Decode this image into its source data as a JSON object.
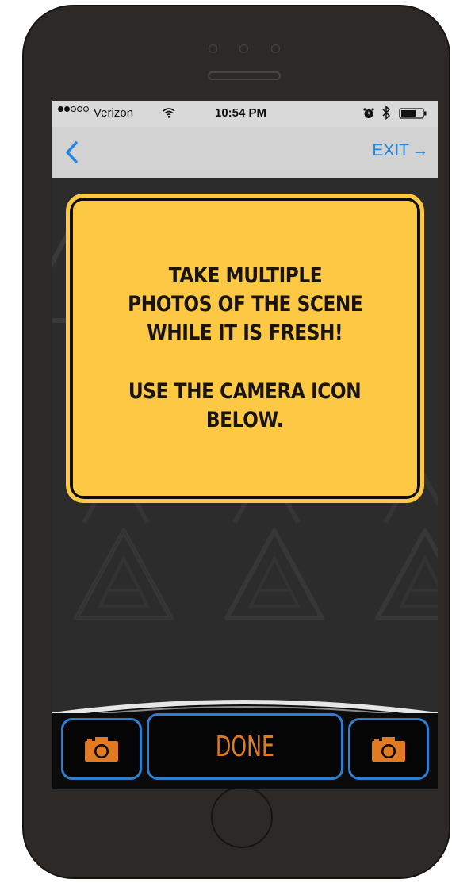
{
  "status_bar": {
    "signal_bars_filled": 2,
    "signal_bars_total": 5,
    "carrier": "Verizon",
    "time": "10:54 PM",
    "icons": [
      "wifi-icon",
      "alarm-icon",
      "bluetooth-icon",
      "battery-icon"
    ]
  },
  "nav": {
    "back_icon": "chevron-left-icon",
    "exit_label": "EXIT",
    "exit_icon": "arrow-right-icon"
  },
  "sign": {
    "lines": [
      "TAKE MULTIPLE",
      "PHOTOS OF THE SCENE",
      "WHILE IT IS FRESH!",
      "",
      "USE THE CAMERA ICON",
      "BELOW."
    ]
  },
  "toolbar": {
    "left_icon": "camera-icon",
    "done_label": "DONE",
    "right_icon": "camera-icon"
  },
  "colors": {
    "accent_blue": "#1e87e6",
    "sign_yellow": "#fdc945",
    "button_border": "#2e7fd0",
    "done_orange": "#e07b23"
  }
}
